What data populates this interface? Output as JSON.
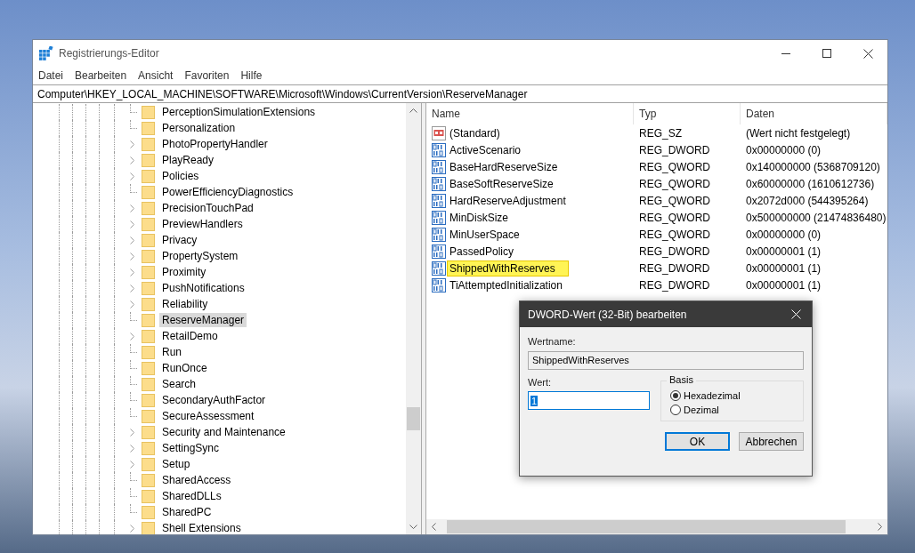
{
  "window": {
    "title": "Registrierungs-Editor"
  },
  "menu": [
    "Datei",
    "Bearbeiten",
    "Ansicht",
    "Favoriten",
    "Hilfe"
  ],
  "address": "Computer\\HKEY_LOCAL_MACHINE\\SOFTWARE\\Microsoft\\Windows\\CurrentVersion\\ReserveManager",
  "tree": [
    {
      "label": "PerceptionSimulationExtensions",
      "expandable": false,
      "selected": false
    },
    {
      "label": "Personalization",
      "expandable": false,
      "selected": false
    },
    {
      "label": "PhotoPropertyHandler",
      "expandable": true,
      "selected": false
    },
    {
      "label": "PlayReady",
      "expandable": true,
      "selected": false
    },
    {
      "label": "Policies",
      "expandable": true,
      "selected": false
    },
    {
      "label": "PowerEfficiencyDiagnostics",
      "expandable": false,
      "selected": false
    },
    {
      "label": "PrecisionTouchPad",
      "expandable": true,
      "selected": false
    },
    {
      "label": "PreviewHandlers",
      "expandable": true,
      "selected": false
    },
    {
      "label": "Privacy",
      "expandable": true,
      "selected": false
    },
    {
      "label": "PropertySystem",
      "expandable": true,
      "selected": false
    },
    {
      "label": "Proximity",
      "expandable": true,
      "selected": false
    },
    {
      "label": "PushNotifications",
      "expandable": true,
      "selected": false
    },
    {
      "label": "Reliability",
      "expandable": true,
      "selected": false
    },
    {
      "label": "ReserveManager",
      "expandable": false,
      "selected": true
    },
    {
      "label": "RetailDemo",
      "expandable": true,
      "selected": false
    },
    {
      "label": "Run",
      "expandable": false,
      "selected": false
    },
    {
      "label": "RunOnce",
      "expandable": false,
      "selected": false
    },
    {
      "label": "Search",
      "expandable": false,
      "selected": false
    },
    {
      "label": "SecondaryAuthFactor",
      "expandable": false,
      "selected": false
    },
    {
      "label": "SecureAssessment",
      "expandable": false,
      "selected": false
    },
    {
      "label": "Security and Maintenance",
      "expandable": true,
      "selected": false
    },
    {
      "label": "SettingSync",
      "expandable": true,
      "selected": false
    },
    {
      "label": "Setup",
      "expandable": true,
      "selected": false
    },
    {
      "label": "SharedAccess",
      "expandable": false,
      "selected": false
    },
    {
      "label": "SharedDLLs",
      "expandable": false,
      "selected": false
    },
    {
      "label": "SharedPC",
      "expandable": false,
      "selected": false
    },
    {
      "label": "Shell Extensions",
      "expandable": true,
      "selected": false
    }
  ],
  "values": {
    "columns": [
      "Name",
      "Typ",
      "Daten"
    ],
    "rows": [
      {
        "kind": "string",
        "name": "(Standard)",
        "type": "REG_SZ",
        "data": "(Wert nicht festgelegt)",
        "selected": false
      },
      {
        "kind": "binary",
        "name": "ActiveScenario",
        "type": "REG_DWORD",
        "data": "0x00000000 (0)",
        "selected": false
      },
      {
        "kind": "binary",
        "name": "BaseHardReserveSize",
        "type": "REG_QWORD",
        "data": "0x140000000 (5368709120)",
        "selected": false
      },
      {
        "kind": "binary",
        "name": "BaseSoftReserveSize",
        "type": "REG_QWORD",
        "data": "0x60000000 (1610612736)",
        "selected": false
      },
      {
        "kind": "binary",
        "name": "HardReserveAdjustment",
        "type": "REG_QWORD",
        "data": "0x2072d000 (544395264)",
        "selected": false
      },
      {
        "kind": "binary",
        "name": "MinDiskSize",
        "type": "REG_QWORD",
        "data": "0x500000000 (21474836480)",
        "selected": false
      },
      {
        "kind": "binary",
        "name": "MinUserSpace",
        "type": "REG_QWORD",
        "data": "0x00000000 (0)",
        "selected": false
      },
      {
        "kind": "binary",
        "name": "PassedPolicy",
        "type": "REG_DWORD",
        "data": "0x00000001 (1)",
        "selected": false
      },
      {
        "kind": "binary",
        "name": "ShippedWithReserves",
        "type": "REG_DWORD",
        "data": "0x00000001 (1)",
        "selected": true
      },
      {
        "kind": "binary",
        "name": "TiAttemptedInitialization",
        "type": "REG_DWORD",
        "data": "0x00000001 (1)",
        "selected": false
      }
    ]
  },
  "dialog": {
    "title": "DWORD-Wert (32-Bit) bearbeiten",
    "name_label": "Wertname:",
    "name_value": "ShippedWithReserves",
    "value_label": "Wert:",
    "value": "1",
    "base_label": "Basis",
    "bases": [
      {
        "label": "Hexadezimal",
        "selected": true
      },
      {
        "label": "Dezimal",
        "selected": false
      }
    ],
    "buttons": [
      {
        "label": "OK",
        "default": true
      },
      {
        "label": "Abbrechen",
        "default": false
      }
    ]
  }
}
